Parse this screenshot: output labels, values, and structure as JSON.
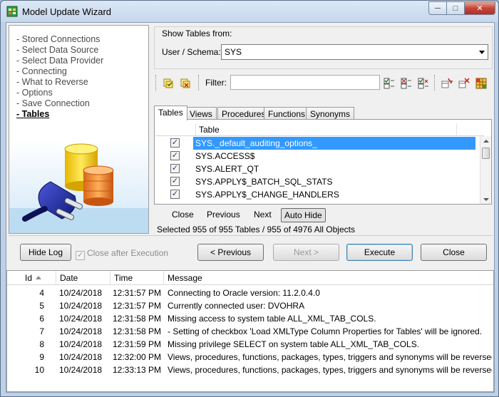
{
  "window": {
    "title": "Model Update Wizard",
    "icon": "app-database-icon",
    "controls": [
      "minimize-icon",
      "maximize-icon",
      "close-icon"
    ]
  },
  "nav": {
    "items": [
      {
        "label": "- Stored Connections",
        "active": false
      },
      {
        "label": "- Select Data Source",
        "active": false
      },
      {
        "label": "- Select Data Provider",
        "active": false
      },
      {
        "label": "- Connecting",
        "active": false
      },
      {
        "label": "- What to Reverse",
        "active": false
      },
      {
        "label": "- Options",
        "active": false
      },
      {
        "label": "- Save Connection",
        "active": false
      },
      {
        "label": "- Tables",
        "active": true
      }
    ],
    "illustration": "database-plug-icon"
  },
  "show_tables": {
    "group_label": "Show Tables from:",
    "schema_label": "User / Schema:",
    "schema_value": "SYS"
  },
  "toolbar": {
    "filter_label": "Filter:",
    "filter_value": "",
    "icons": [
      "select-all-icon",
      "deselect-icon",
      "check-all-icon",
      "uncheck-all-icon",
      "invert-check-icon",
      "add-table-icon",
      "remove-table-icon",
      "grid-icon"
    ]
  },
  "tabs": [
    {
      "label": "Tables",
      "active": true
    },
    {
      "label": "Views",
      "active": false
    },
    {
      "label": "Procedures",
      "active": false
    },
    {
      "label": "Functions",
      "active": false
    },
    {
      "label": "Synonyms",
      "active": false
    }
  ],
  "table_list": {
    "header": "Table",
    "rows": [
      {
        "name": "SYS._default_auditing_options_",
        "checked": true,
        "selected": true
      },
      {
        "name": "SYS.ACCESS$",
        "checked": true,
        "selected": false
      },
      {
        "name": "SYS.ALERT_QT",
        "checked": true,
        "selected": false
      },
      {
        "name": "SYS.APPLY$_BATCH_SQL_STATS",
        "checked": true,
        "selected": false
      },
      {
        "name": "SYS.APPLY$_CHANGE_HANDLERS",
        "checked": true,
        "selected": false
      }
    ]
  },
  "list_actions": {
    "close": "Close",
    "previous": "Previous",
    "next": "Next",
    "auto_hide": "Auto Hide"
  },
  "summary": "Selected 955 of 955 Tables / 955 of 4976 All Objects",
  "buttons": {
    "hide_log": "Hide Log",
    "close_after_execution": "Close after Execution",
    "close_after_execution_checked": true,
    "previous": "< Previous",
    "next": "Next >",
    "execute": "Execute",
    "close": "Close"
  },
  "log": {
    "columns": {
      "id": "Id",
      "date": "Date",
      "time": "Time",
      "message": "Message"
    },
    "rows": [
      {
        "id": "4",
        "date": "10/24/2018",
        "time": "12:31:57 PM",
        "message": "Connecting to Oracle version: 11.2.0.4.0"
      },
      {
        "id": "5",
        "date": "10/24/2018",
        "time": "12:31:57 PM",
        "message": "Currently connected user: DVOHRA"
      },
      {
        "id": "6",
        "date": "10/24/2018",
        "time": "12:31:58 PM",
        "message": "Missing access to system table ALL_XML_TAB_COLS."
      },
      {
        "id": "7",
        "date": "10/24/2018",
        "time": "12:31:58 PM",
        "message": " - Setting of checkbox 'Load XMLType Column Properties for Tables' will be ignored."
      },
      {
        "id": "8",
        "date": "10/24/2018",
        "time": "12:31:59 PM",
        "message": "Missing privilege SELECT on system table ALL_XML_TAB_COLS."
      },
      {
        "id": "9",
        "date": "10/24/2018",
        "time": "12:32:00 PM",
        "message": "Views, procedures, functions, packages, types, triggers and synonyms will be reversed from e..."
      },
      {
        "id": "10",
        "date": "10/24/2018",
        "time": "12:33:13 PM",
        "message": "Views, procedures, functions, packages, types, triggers and synonyms will be reversed from e..."
      }
    ]
  },
  "colors": {
    "selection": "#3399ff",
    "title_gradient_top": "#dbe7f5",
    "close_button": "#c5453a"
  }
}
